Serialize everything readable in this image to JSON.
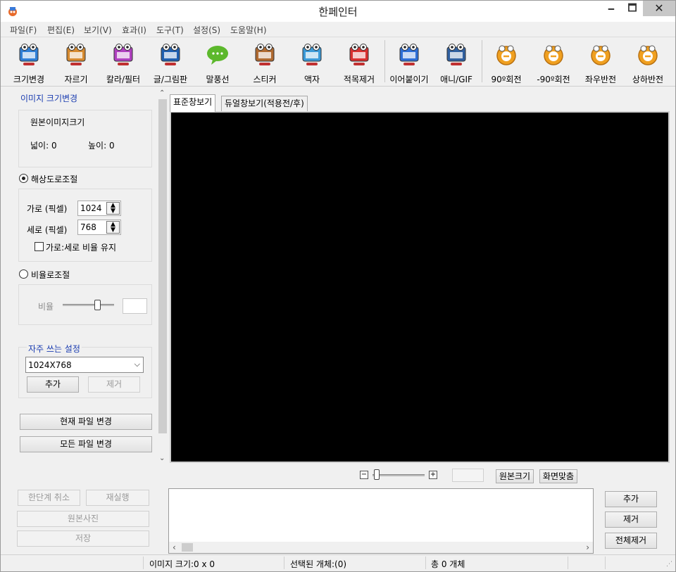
{
  "window": {
    "title": "한페인터",
    "min": "🗕",
    "max": "🗖",
    "close": "✕"
  },
  "menu": [
    "파일(F)",
    "편집(E)",
    "보기(V)",
    "효과(I)",
    "도구(T)",
    "설정(S)",
    "도움말(H)"
  ],
  "toolbar": [
    {
      "label": "크기변경",
      "icon": "resize-icon",
      "color": "#2f7fd6"
    },
    {
      "label": "자르기",
      "icon": "crop-icon",
      "color": "#d68a2f"
    },
    {
      "label": "칼라/필터",
      "icon": "color-filter-icon",
      "color": "#b040c0"
    },
    {
      "label": "글/그림판",
      "icon": "text-draw-icon",
      "color": "#2060b0"
    },
    {
      "label": "말풍선",
      "icon": "speech-bubble-icon",
      "color": "#5cb82c"
    },
    {
      "label": "스티커",
      "icon": "sticker-icon",
      "color": "#b06a30"
    },
    {
      "label": "액자",
      "icon": "frame-icon",
      "color": "#3a9ad8"
    },
    {
      "label": "적목제거",
      "icon": "red-eye-icon",
      "color": "#d83030"
    },
    {
      "label": "이어붙이기",
      "icon": "merge-icon",
      "color": "#2f6fd6"
    },
    {
      "label": "애니/GIF",
      "icon": "gif-animation-icon",
      "color": "#3060a0"
    },
    {
      "label": "90º회전",
      "icon": "rotate-cw-icon",
      "color": "#f0a020"
    },
    {
      "label": "-90º회전",
      "icon": "rotate-ccw-icon",
      "color": "#f0a020"
    },
    {
      "label": "좌우반전",
      "icon": "flip-horizontal-icon",
      "color": "#f0a020"
    },
    {
      "label": "상하반전",
      "icon": "flip-vertical-icon",
      "color": "#f0a020"
    }
  ],
  "left": {
    "section_title": "이미지 크기변경",
    "orig_title": "원본이미지크기",
    "width_label": "넓이: 0",
    "height_label": "높이:  0",
    "res_radio": "해상도로조절",
    "w_label": "가로 (픽셀)",
    "w_value": "1024",
    "h_label": "세로 (픽셀)",
    "h_value": "768",
    "keep_ratio": "가로:세로 비율 유지",
    "ratio_radio": "비율로조절",
    "ratio_label": "비율",
    "ratio_value": 0.7,
    "fav_title": "자주 쓰는 설정",
    "fav_value": "1024X768",
    "add_btn": "추가",
    "remove_btn": "제거",
    "apply_current": "현재 파일 변경",
    "apply_all": "모든 파일 변경",
    "undo": "한단계 취소",
    "redo": "재실행",
    "original": "원본사진",
    "save": "저장"
  },
  "tabs": [
    "표준창보기",
    "듀얼창보기(적용전/후)"
  ],
  "zoom": {
    "minus": "−",
    "plus": "+",
    "original_size": "원본크기",
    "fit": "화면맞춤",
    "level": 0.0
  },
  "list_buttons": [
    "추가",
    "제거",
    "전체제거"
  ],
  "status": {
    "image_size": "이미지 크기:0 x 0",
    "selected": "선택된 개체:(0)",
    "total": "총 0 개체"
  }
}
